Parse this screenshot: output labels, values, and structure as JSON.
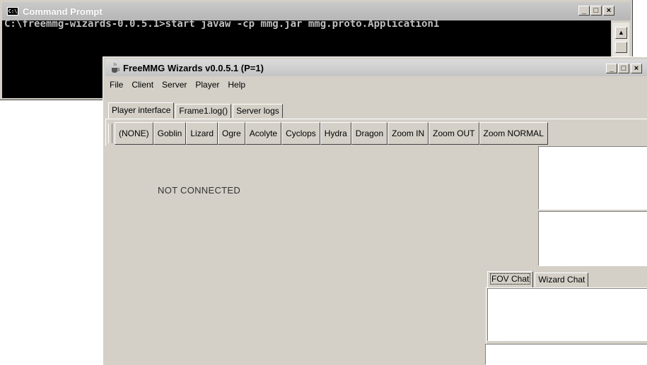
{
  "cmd": {
    "title": "Command Prompt",
    "icon_text": "C:\\",
    "command_line": "C:\\freemmg-wizards-0.0.5.1>start javaw -cp mmg.jar mmg.proto.Application1",
    "buttons": {
      "minimize": "_",
      "maximize": "□",
      "close": "×"
    },
    "scroll_up_glyph": "▲"
  },
  "app": {
    "title": "FreeMMG Wizards v0.0.5.1 (P=1)",
    "buttons": {
      "minimize": "_",
      "maximize": "□",
      "close": "×"
    },
    "menu": [
      "File",
      "Client",
      "Server",
      "Player",
      "Help"
    ],
    "tabs": [
      "Player interface",
      "Frame1.log()",
      "Server logs"
    ],
    "active_tab": "Player interface",
    "toolbar": [
      "(NONE)",
      "Goblin",
      "Lizard",
      "Ogre",
      "Acolyte",
      "Cyclops",
      "Hydra",
      "Dragon",
      "Zoom IN",
      "Zoom OUT",
      "Zoom NORMAL"
    ],
    "status": "NOT CONNECTED",
    "chat_tabs": [
      "FOV Chat",
      "Wizard Chat"
    ],
    "active_chat_tab": "FOV Chat"
  },
  "colors": {
    "window_face": "#d4d0c8",
    "console_bg": "#000000",
    "console_text": "#c0c0c0"
  }
}
